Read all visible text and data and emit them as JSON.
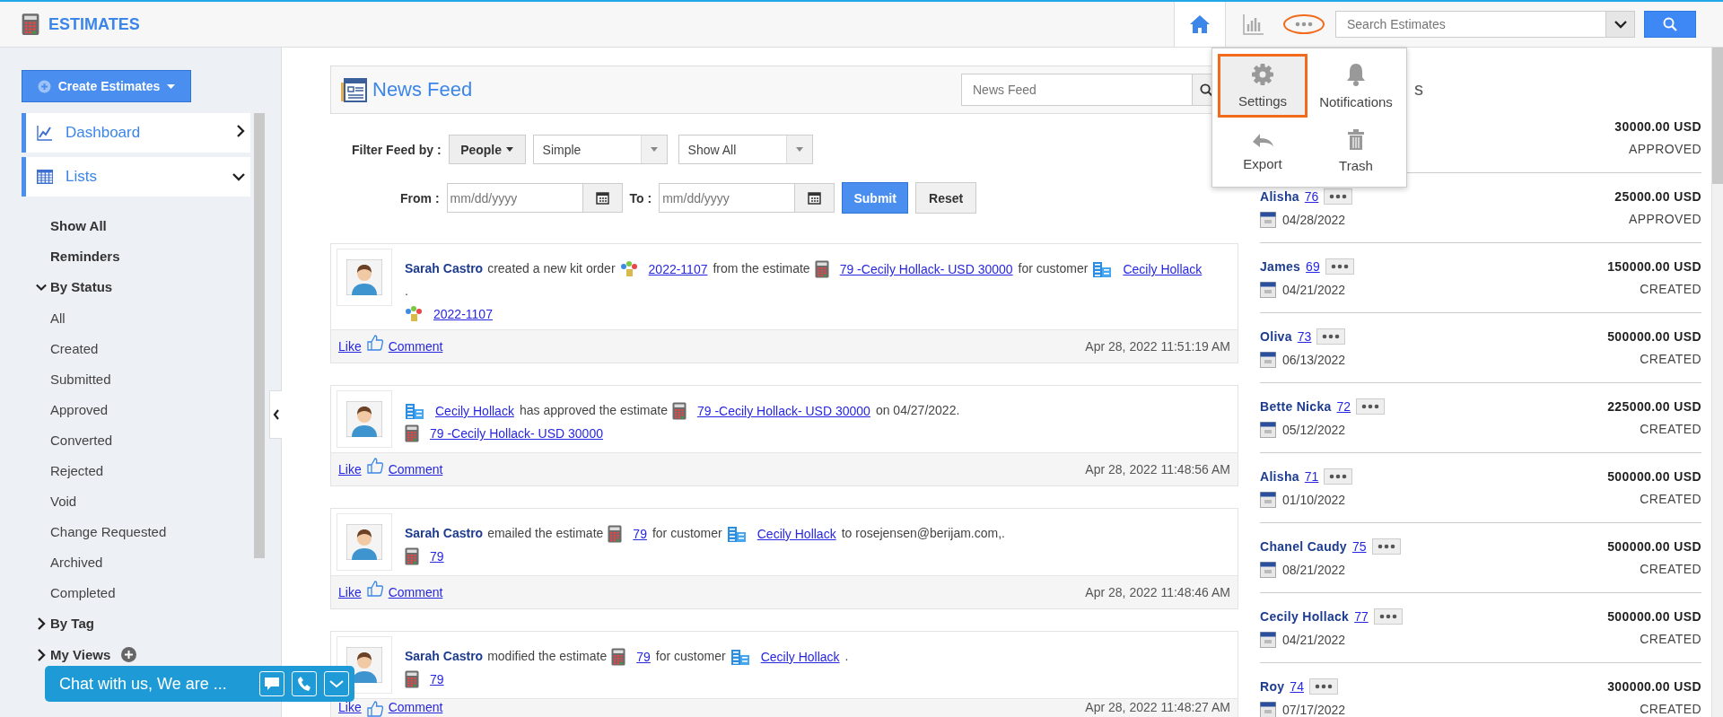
{
  "app": {
    "title": "ESTIMATES"
  },
  "topbar": {
    "search": {
      "placeholder": "Search Estimates"
    }
  },
  "more_menu": {
    "items": [
      {
        "label": "Settings",
        "kind": "settings",
        "selected": true
      },
      {
        "label": "Notifications",
        "kind": "notifications",
        "selected": false
      },
      {
        "label": "Export",
        "kind": "export",
        "selected": false
      },
      {
        "label": "Trash",
        "kind": "trash",
        "selected": false
      }
    ]
  },
  "sidebar": {
    "create_button": "Create Estimates",
    "nav": [
      {
        "label": "Dashboard",
        "kind": "dashboard",
        "expanded": false
      },
      {
        "label": "Lists",
        "kind": "lists",
        "expanded": true
      }
    ],
    "list": [
      {
        "label": "Show All",
        "kind": "link"
      },
      {
        "label": "Reminders",
        "kind": "link"
      },
      {
        "label": "By Status",
        "kind": "group",
        "expanded": true,
        "add": false,
        "children": [
          {
            "label": "All"
          },
          {
            "label": "Created"
          },
          {
            "label": "Submitted"
          },
          {
            "label": "Approved"
          },
          {
            "label": "Converted"
          },
          {
            "label": "Rejected"
          },
          {
            "label": "Void"
          },
          {
            "label": "Change Requested"
          },
          {
            "label": "Archived"
          },
          {
            "label": "Completed"
          }
        ]
      },
      {
        "label": "By Tag",
        "kind": "group",
        "expanded": false,
        "add": false
      },
      {
        "label": "My Views",
        "kind": "group",
        "expanded": false,
        "add": true
      }
    ]
  },
  "news_feed": {
    "title": "News Feed",
    "search": {
      "placeholder": "News Feed"
    },
    "filter_label": "Filter Feed by :",
    "people_button": "People",
    "type_select": "Simple",
    "scope_select": "Show All",
    "from_label": "From :",
    "from": {
      "placeholder": "mm/dd/yyyy"
    },
    "to_label": "To :",
    "to": {
      "placeholder": "mm/dd/yyyy"
    },
    "submit": "Submit",
    "reset": "Reset",
    "posts": [
      {
        "lines": [
          [
            {
              "kind": "actor",
              "text": "Sarah Castro"
            },
            {
              "kind": "text",
              "text": "created a new kit order"
            },
            {
              "kind": "kit_link",
              "text": "2022-1107"
            },
            {
              "kind": "text",
              "text": "from the estimate"
            },
            {
              "kind": "estimate_link",
              "text": "79 -Cecily Hollack- USD 30000"
            },
            {
              "kind": "text",
              "text": "for customer"
            },
            {
              "kind": "customer_link",
              "text": "Cecily Hollack"
            }
          ],
          [
            {
              "kind": "text",
              "text": "."
            }
          ],
          [
            {
              "kind": "kit_link",
              "text": "2022-1107"
            }
          ]
        ],
        "like": "Like",
        "comment": "Comment",
        "time": "Apr 28, 2022 11:51:19 AM"
      },
      {
        "lines": [
          [
            {
              "kind": "customer_link",
              "text": "Cecily Hollack"
            },
            {
              "kind": "text",
              "text": "has approved the estimate"
            },
            {
              "kind": "estimate_link",
              "text": "79 -Cecily Hollack- USD 30000"
            },
            {
              "kind": "text",
              "text": "on 04/27/2022."
            }
          ],
          [
            {
              "kind": "estimate_link",
              "text": "79 -Cecily Hollack- USD 30000"
            }
          ]
        ],
        "like": "Like",
        "comment": "Comment",
        "time": "Apr 28, 2022 11:48:56 AM"
      },
      {
        "lines": [
          [
            {
              "kind": "actor",
              "text": "Sarah Castro"
            },
            {
              "kind": "text",
              "text": "emailed the estimate"
            },
            {
              "kind": "estimate_link",
              "text": "79"
            },
            {
              "kind": "text",
              "text": "for customer"
            },
            {
              "kind": "customer_link",
              "text": "Cecily Hollack"
            },
            {
              "kind": "text",
              "text": "to rosejensen@berijam.com,."
            }
          ],
          [
            {
              "kind": "estimate_link",
              "text": "79"
            }
          ]
        ],
        "like": "Like",
        "comment": "Comment",
        "time": "Apr 28, 2022 11:48:46 AM"
      },
      {
        "lines": [
          [
            {
              "kind": "actor",
              "text": "Sarah Castro"
            },
            {
              "kind": "text",
              "text": "modified the estimate"
            },
            {
              "kind": "estimate_link",
              "text": "79"
            },
            {
              "kind": "text",
              "text": "for customer"
            },
            {
              "kind": "customer_link",
              "text": "Cecily Hollack"
            },
            {
              "kind": "text",
              "text": "."
            }
          ],
          [
            {
              "kind": "estimate_link",
              "text": "79"
            }
          ]
        ],
        "like": "Like",
        "comment": "Comment",
        "time": "Apr 28, 2022 11:48:27 AM"
      }
    ]
  },
  "estimates_panel": {
    "heading": "s",
    "rows": [
      {
        "amount": "30000.00 USD",
        "status": "APPROVED"
      },
      {
        "name": "Alisha",
        "number": "76",
        "date": "04/28/2022",
        "amount": "25000.00 USD",
        "status": "APPROVED"
      },
      {
        "name": "James",
        "number": "69",
        "date": "04/21/2022",
        "amount": "150000.00 USD",
        "status": "CREATED"
      },
      {
        "name": "Oliva",
        "number": "73",
        "date": "06/13/2022",
        "amount": "500000.00 USD",
        "status": "CREATED"
      },
      {
        "name": "Bette Nicka",
        "number": "72",
        "date": "05/12/2022",
        "amount": "225000.00 USD",
        "status": "CREATED"
      },
      {
        "name": "Alisha",
        "number": "71",
        "date": "01/10/2022",
        "amount": "500000.00 USD",
        "status": "CREATED"
      },
      {
        "name": "Chanel Caudy",
        "number": "75",
        "date": "08/21/2022",
        "amount": "500000.00 USD",
        "status": "CREATED"
      },
      {
        "name": "Cecily Hollack",
        "number": "77",
        "date": "04/21/2022",
        "amount": "500000.00 USD",
        "status": "CREATED"
      },
      {
        "name": "Roy",
        "number": "74",
        "date": "07/17/2022",
        "amount": "300000.00 USD",
        "status": "CREATED"
      }
    ]
  },
  "chat": {
    "label": "Chat with us, We are ..."
  }
}
